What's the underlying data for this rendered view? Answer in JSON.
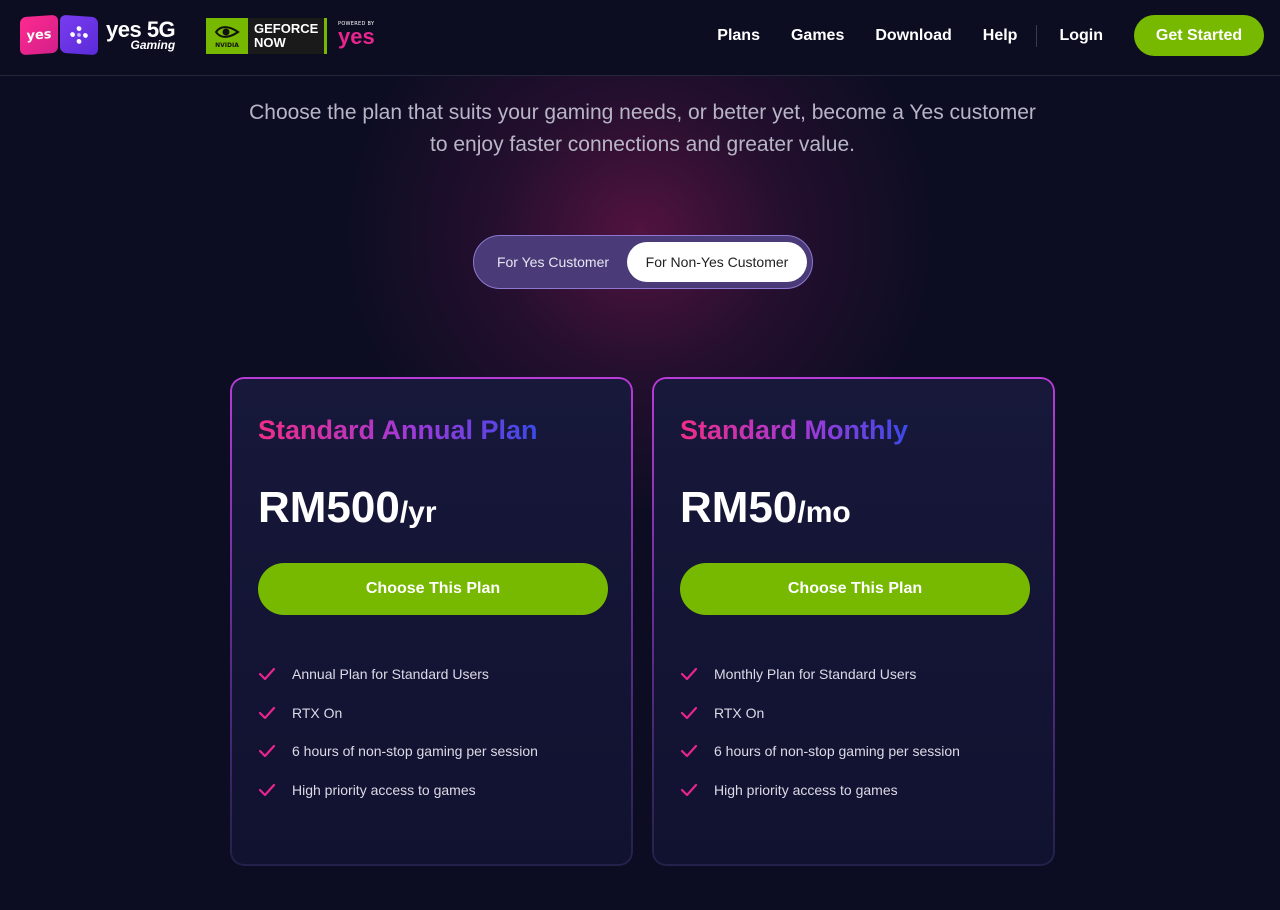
{
  "header": {
    "brand": {
      "badge_text": "yes",
      "main": "yes 5G",
      "sub": "Gaming"
    },
    "partner": {
      "line1": "GEFORCE",
      "line2": "NOW",
      "eye_label": "NVIDIA"
    },
    "powered": {
      "label": "POWERED BY",
      "brand": "yes"
    },
    "nav": [
      {
        "label": "Plans"
      },
      {
        "label": "Games"
      },
      {
        "label": "Download"
      },
      {
        "label": "Help"
      }
    ],
    "login_label": "Login",
    "cta_label": "Get Started"
  },
  "intro": "Choose the plan that suits your gaming needs, or better yet, become a Yes customer to enjoy faster connections and greater value.",
  "toggle": {
    "options": [
      "For Yes Customer",
      "For Non-Yes Customer"
    ],
    "selected": "For Non-Yes Customer"
  },
  "plans": [
    {
      "title": "Standard Annual Plan",
      "price": "RM500",
      "period": "/yr",
      "button": "Choose This Plan",
      "features": [
        "Annual Plan for Standard Users",
        "RTX On",
        "6 hours of non-stop gaming per session",
        "High priority access to games"
      ]
    },
    {
      "title": "Standard Monthly",
      "price": "RM50",
      "period": "/mo",
      "button": "Choose This Plan",
      "features": [
        "Monthly Plan for Standard Users",
        "RTX On",
        "6 hours of non-stop gaming per session",
        "High priority access to games"
      ]
    }
  ],
  "colors": {
    "background": "#0c0d22",
    "accent_green": "#76b900",
    "brand_pink": "#e8248f",
    "check": "#e8248f"
  },
  "icons": [
    "gamepad-icon",
    "nvidia-eye-icon",
    "check-icon"
  ]
}
